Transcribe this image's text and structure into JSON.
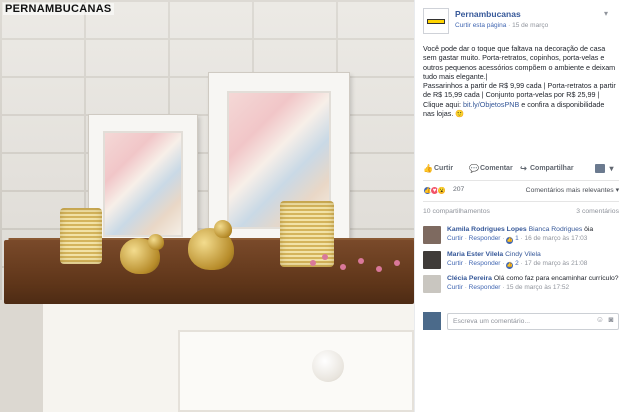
{
  "photo": {
    "watermark": "PERNAMBUCANAS",
    "flower_color": "#d9789a",
    "wood_color": "#6b3f20"
  },
  "post": {
    "page_name": "Pernambucanas",
    "like_page": "Curtir esta página",
    "separator": " · ",
    "date": "15 de março",
    "menu_icon": "chevron-down-icon",
    "text_1": "Você pode dar o toque que faltava na decoração de casa sem gastar muito. Porta-retratos, copinhos, porta-velas e outros pequenos acessórios compõem o ambiente e deixam tudo mais elegante.|",
    "text_2": "Passarinhos a partir de R$ 9,99 cada | Porta-retratos a partir de R$ 15,99 cada | Conjunto porta-velas por R$ 25,99 | Clique aqui: ",
    "link": "bit.ly/ObjetosPNB",
    "text_3": " e confira a disponibilidade nas lojas. 🙂"
  },
  "actions": {
    "like": "Curtir",
    "comment": "Comentar",
    "share": "Compartilhar"
  },
  "reactions": {
    "count": "207",
    "relevance": "Comentários mais relevantes ▾",
    "shares": "10 compartilhamentos",
    "comments": "3 comentários"
  },
  "comments": [
    {
      "author": "Kamila Rodrigues Lopes",
      "text": "Bianca Rodrigues",
      "suffix": " ôia",
      "like": "Curtir",
      "reply": "Responder",
      "likes": "1",
      "date": "16 de março às 17:03"
    },
    {
      "author": "Maria Ester Vilela",
      "text": "Cindy Vilela",
      "suffix": "",
      "like": "Curtir",
      "reply": "Responder",
      "likes": "2",
      "date": "17 de março às 21:08"
    },
    {
      "author": "Clécia Pereira",
      "text": "",
      "suffix": " Olá como faz para encaminhar currículo?",
      "like": "Curtir",
      "reply": "Responder",
      "likes": "",
      "date": "15 de março às 17:52"
    }
  ],
  "composer": {
    "placeholder": "Escreva um comentário...",
    "emoji_icon": "smile-icon",
    "camera_icon": "camera-icon"
  },
  "colors": {
    "link": "#365899",
    "accent": "#4267b2",
    "muted": "#90949c",
    "brand_yellow": "#ffd400"
  }
}
